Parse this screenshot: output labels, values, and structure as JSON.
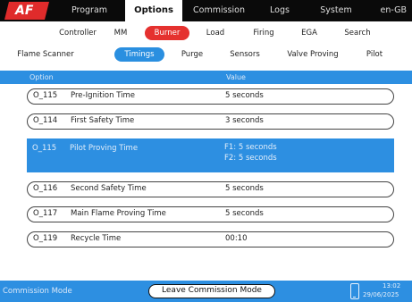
{
  "logo": "AF",
  "top_tabs": [
    {
      "label": "Program"
    },
    {
      "label": "Options"
    },
    {
      "label": "Commission"
    },
    {
      "label": "Logs"
    },
    {
      "label": "System"
    }
  ],
  "language": "en-GB",
  "sub_tabs": [
    {
      "label": "Controller"
    },
    {
      "label": "MM"
    },
    {
      "label": "Burner"
    },
    {
      "label": "Load"
    },
    {
      "label": "Firing"
    },
    {
      "label": "EGA"
    },
    {
      "label": "Search"
    }
  ],
  "burner_tabs": [
    {
      "label": "Flame Scanner"
    },
    {
      "label": "Timings"
    },
    {
      "label": "Purge"
    },
    {
      "label": "Sensors"
    },
    {
      "label": "Valve Proving"
    },
    {
      "label": "Pilot"
    }
  ],
  "table": {
    "header_option": "Option",
    "header_value": "Value",
    "rows": [
      {
        "code": "O_115",
        "name": "Pre-Ignition Time",
        "value": "5 seconds"
      },
      {
        "code": "O_114",
        "name": "First Safety Time",
        "value": "3 seconds"
      },
      {
        "code": "O_115",
        "name": "Pilot Proving Time",
        "value1": "F1: 5 seconds",
        "value2": "F2: 5 seconds"
      },
      {
        "code": "O_116",
        "name": "Second Safety Time",
        "value": "5 seconds"
      },
      {
        "code": "O_117",
        "name": "Main Flame Proving Time",
        "value": "5 seconds"
      },
      {
        "code": "O_119",
        "name": "Recycle Time",
        "value": "00:10"
      }
    ]
  },
  "status": {
    "mode": "Commission Mode",
    "leave_button": "Leave Commission Mode",
    "time": "13:02",
    "date": "29/06/2025"
  },
  "colors": {
    "accent_blue": "#2d8fe1",
    "accent_red": "#e5312f",
    "topbar": "#0a0a0a"
  }
}
